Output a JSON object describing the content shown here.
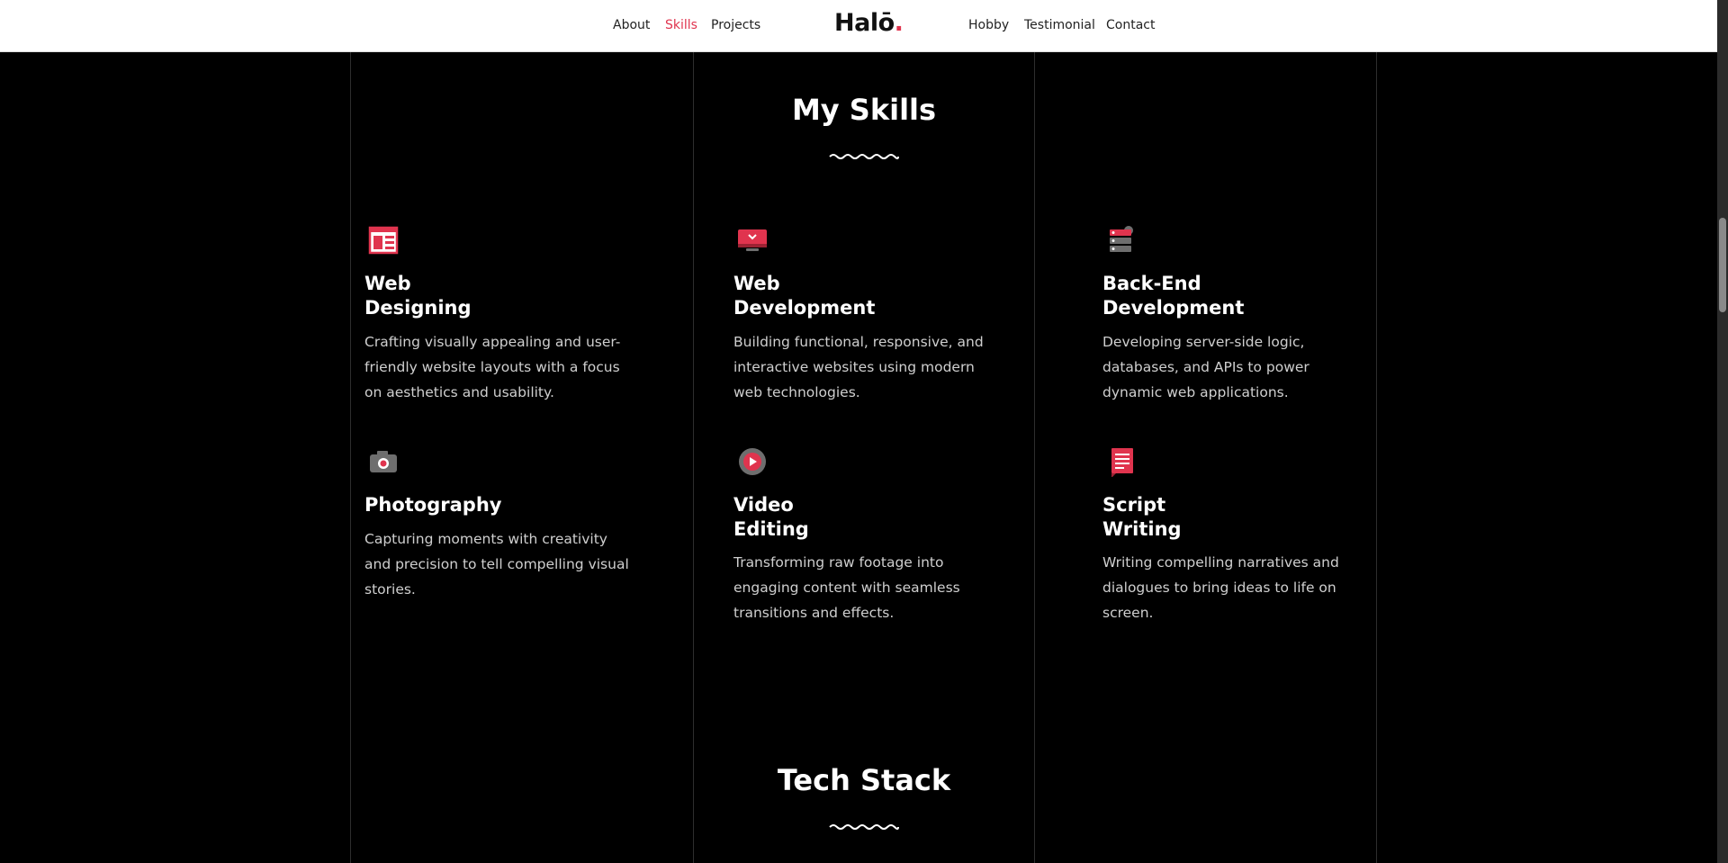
{
  "nav": {
    "left_links": [
      "About",
      "Skills",
      "Projects"
    ],
    "right_links": [
      "Hobby",
      "Testimonial",
      "Contact"
    ],
    "active": "Skills",
    "logo_text": "Halō",
    "logo_dot": "."
  },
  "skills_section": {
    "title": "My Skills",
    "cards": [
      {
        "icon": "web-layout-icon",
        "title_line1": "Web",
        "title_line2": "Designing",
        "description": "Crafting visually appealing and user-friendly website layouts with a focus on aesthetics and usability."
      },
      {
        "icon": "monitor-icon",
        "title_line1": "Web",
        "title_line2": "Development",
        "description": "Building functional, responsive, and interactive websites using modern web technologies."
      },
      {
        "icon": "server-icon",
        "title_line1": "Back-End",
        "title_line2": "Development",
        "description": "Developing server-side logic, databases, and APIs to power dynamic web applications."
      },
      {
        "icon": "camera-icon",
        "title_line1": "Photography",
        "title_line2": "",
        "description": "Capturing moments with creativity and precision to tell compelling visual stories."
      },
      {
        "icon": "play-icon",
        "title_line1": "Video",
        "title_line2": "Editing",
        "description": "Transforming raw footage into engaging content with seamless transitions and effects."
      },
      {
        "icon": "script-icon",
        "title_line1": "Script",
        "title_line2": "Writing",
        "description": "Writing compelling narratives and dialogues to bring ideas to life on screen."
      }
    ]
  },
  "tech_section": {
    "title": "Tech Stack"
  },
  "colors": {
    "accent": "#e0344e",
    "background": "#000000",
    "nav_bg": "#ffffff",
    "icon_gray": "#6e6e6e"
  }
}
